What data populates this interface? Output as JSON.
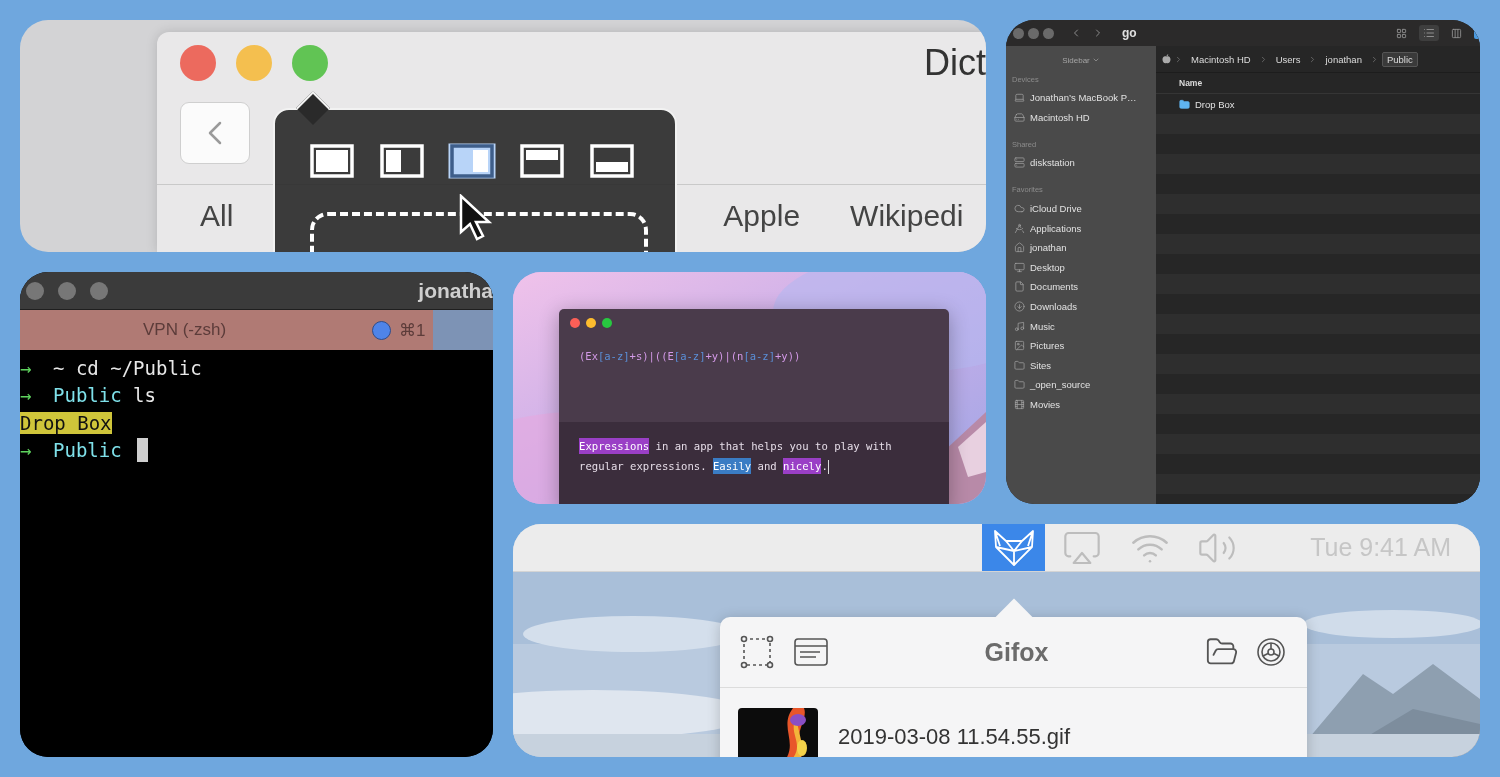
{
  "dictionary": {
    "title": "Dict",
    "layout_options": [
      {
        "kind": "full",
        "selected": false
      },
      {
        "kind": "left",
        "selected": false
      },
      {
        "kind": "right",
        "selected": true
      },
      {
        "kind": "top",
        "selected": false
      },
      {
        "kind": "bottom",
        "selected": false
      }
    ],
    "tabs": [
      {
        "label": "All",
        "selected": false
      },
      {
        "label": "Apple",
        "selected": false
      },
      {
        "label": "Wikipedi",
        "selected": false
      }
    ]
  },
  "finder": {
    "title": "go",
    "sidebar_header": "Sidebar",
    "sections": [
      {
        "label": "Devices",
        "items": [
          {
            "label": "Jonathan’s MacBook P…",
            "kind": "computer"
          },
          {
            "label": "Macintosh HD",
            "kind": "disk"
          }
        ]
      },
      {
        "label": "Shared",
        "items": [
          {
            "label": "diskstation",
            "kind": "server"
          }
        ]
      },
      {
        "label": "Favorites",
        "items": [
          {
            "label": "iCloud Drive",
            "kind": "cloud"
          },
          {
            "label": "Applications",
            "kind": "apps"
          },
          {
            "label": "jonathan",
            "kind": "home"
          },
          {
            "label": "Desktop",
            "kind": "desktop"
          },
          {
            "label": "Documents",
            "kind": "documents"
          },
          {
            "label": "Downloads",
            "kind": "downloads"
          },
          {
            "label": "Music",
            "kind": "music"
          },
          {
            "label": "Pictures",
            "kind": "pictures"
          },
          {
            "label": "Sites",
            "kind": "folder"
          },
          {
            "label": "_open_source",
            "kind": "folder"
          },
          {
            "label": "Movies",
            "kind": "movies"
          }
        ]
      }
    ],
    "path": [
      {
        "label": "Macintosh HD",
        "selected": false
      },
      {
        "label": "Users",
        "selected": false
      },
      {
        "label": "jonathan",
        "selected": false
      },
      {
        "label": "Public",
        "selected": true
      }
    ],
    "columns": [
      "Name"
    ],
    "rows": [
      {
        "name": "Drop Box"
      }
    ]
  },
  "terminal": {
    "title": "jonatha",
    "tabs": [
      {
        "label": "VPN (-zsh)",
        "shortcut": "⌘1",
        "selected": true
      }
    ],
    "lines": [
      {
        "kind": "prompt",
        "arrow": "→",
        "dir": "~",
        "command": "cd ~/Public"
      },
      {
        "kind": "prompt",
        "arrow": "→",
        "dir": "Public",
        "command": "ls"
      },
      {
        "kind": "output",
        "text": "Drop Box"
      },
      {
        "kind": "prompt",
        "arrow": "→",
        "dir": "Public",
        "cursor": true
      }
    ]
  },
  "expressions": {
    "pattern": "(Ex[a-z]+s)|((E[a-z]+y)|(n[a-z]+y))",
    "sample": [
      {
        "text": "Expressions",
        "color": "#9a3fc6"
      },
      {
        "text": " in an app that helps you to play with regular expressions. "
      },
      {
        "text": "Easily",
        "color": "#3a7cc4"
      },
      {
        "text": " and "
      },
      {
        "text": "nicely",
        "color": "#9a3fc6"
      },
      {
        "text": "."
      }
    ]
  },
  "gifox": {
    "menu_items": [
      {
        "kind": "gifox",
        "selected": true
      },
      {
        "kind": "airplay",
        "selected": false
      },
      {
        "kind": "wifi",
        "selected": false
      },
      {
        "kind": "volume",
        "selected": false
      }
    ],
    "clock": "Tue 9:41 AM",
    "title": "Gifox",
    "recordings": [
      {
        "name": "2019-03-08 11.54.55.gif"
      }
    ]
  }
}
